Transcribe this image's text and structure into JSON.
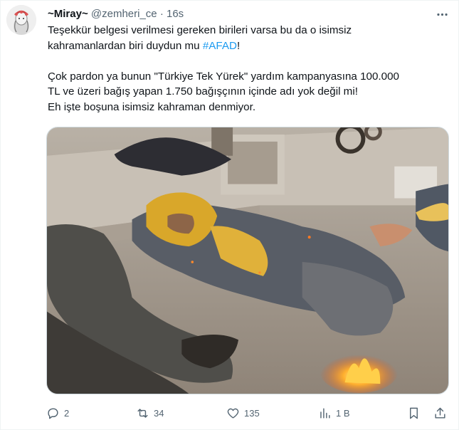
{
  "tweet": {
    "display_name": "~Miray~",
    "handle": "@zemheri_ce",
    "separator": "·",
    "time": "16s",
    "text_line1": "Teşekkür belgesi verilmesi gereken birileri varsa bu da o isimsiz",
    "text_line2_pre": "kahramanlardan biri duydun mu ",
    "hashtag": "#AFAD",
    "text_line2_post": "!",
    "text_line3": "Çok pardon ya bunun \"Türkiye Tek Yürek\" yardım kampanyasına 100.000",
    "text_line4": "TL ve  üzeri bağış yapan 1.750 bağışçının içinde adı yok değil mi!",
    "text_line5": "Eh işte boşuna isimsiz kahraman denmiyor."
  },
  "actions": {
    "replies": "2",
    "retweets": "34",
    "likes": "135",
    "views": "1 B"
  },
  "colors": {
    "accent": "#1d9bf0",
    "secondary_text": "#536471",
    "primary_text": "#0f1419"
  },
  "icons": [
    "more-icon",
    "reply-icon",
    "retweet-icon",
    "like-icon",
    "views-icon",
    "bookmark-icon",
    "share-icon"
  ]
}
